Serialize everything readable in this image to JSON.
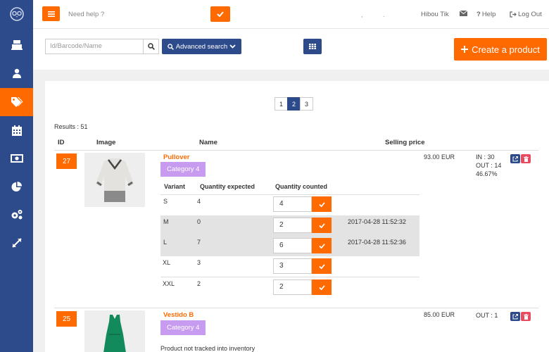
{
  "colors": {
    "primary": "#2d4a8a",
    "accent": "#ff6a00",
    "category": "#c79cf0",
    "danger": "#e84a5f"
  },
  "sidebar": {
    "items": [
      {
        "icon": "owl-logo-icon"
      },
      {
        "icon": "cash-register-icon"
      },
      {
        "icon": "user-icon"
      },
      {
        "icon": "tags-icon",
        "active": true
      },
      {
        "icon": "calendar-icon"
      },
      {
        "icon": "money-icon"
      },
      {
        "icon": "pie-chart-icon"
      },
      {
        "icon": "cogs-icon"
      },
      {
        "icon": "expand-icon"
      }
    ]
  },
  "topbar": {
    "help_placeholder": "Need help ?",
    "user_name": "Hibou Tik",
    "help_label": "Help",
    "logout_label": "Log Out",
    "dots": [
      ",",
      "."
    ]
  },
  "search": {
    "placeholder": "Id/Barcode/Name",
    "advanced_label": "Advanced search"
  },
  "create_button": "Create a product",
  "pagination": {
    "pages": [
      "1",
      "2",
      "3"
    ],
    "current": "2"
  },
  "results_label": "Results : 51",
  "columns": {
    "id": "ID",
    "image": "Image",
    "name": "Name",
    "price": "Selling price"
  },
  "variant_columns": {
    "variant": "Variant",
    "expected": "Quantity expected",
    "counted": "Quantity counted"
  },
  "products": [
    {
      "id": "27",
      "name": "Pullover",
      "category": "Category 4",
      "price": "93.00 EUR",
      "stock_in": "IN : 30",
      "stock_out": "OUT : 14",
      "stock_pct": "46.67%",
      "variants": [
        {
          "variant": "S",
          "expected": "4",
          "counted": "4",
          "date": ""
        },
        {
          "variant": "M",
          "expected": "0",
          "counted": "2",
          "date": "2017-04-28 11:52:32"
        },
        {
          "variant": "L",
          "expected": "7",
          "counted": "6",
          "date": "2017-04-28 11:52:36"
        },
        {
          "variant": "XL",
          "expected": "3",
          "counted": "3",
          "date": ""
        },
        {
          "variant": "XXL",
          "expected": "2",
          "counted": "2",
          "date": ""
        }
      ]
    },
    {
      "id": "25",
      "name": "Vestido B",
      "category": "Category 4",
      "price": "85.00 EUR",
      "stock_out": "OUT : 1",
      "note": "Product not tracked into inventory"
    }
  ]
}
